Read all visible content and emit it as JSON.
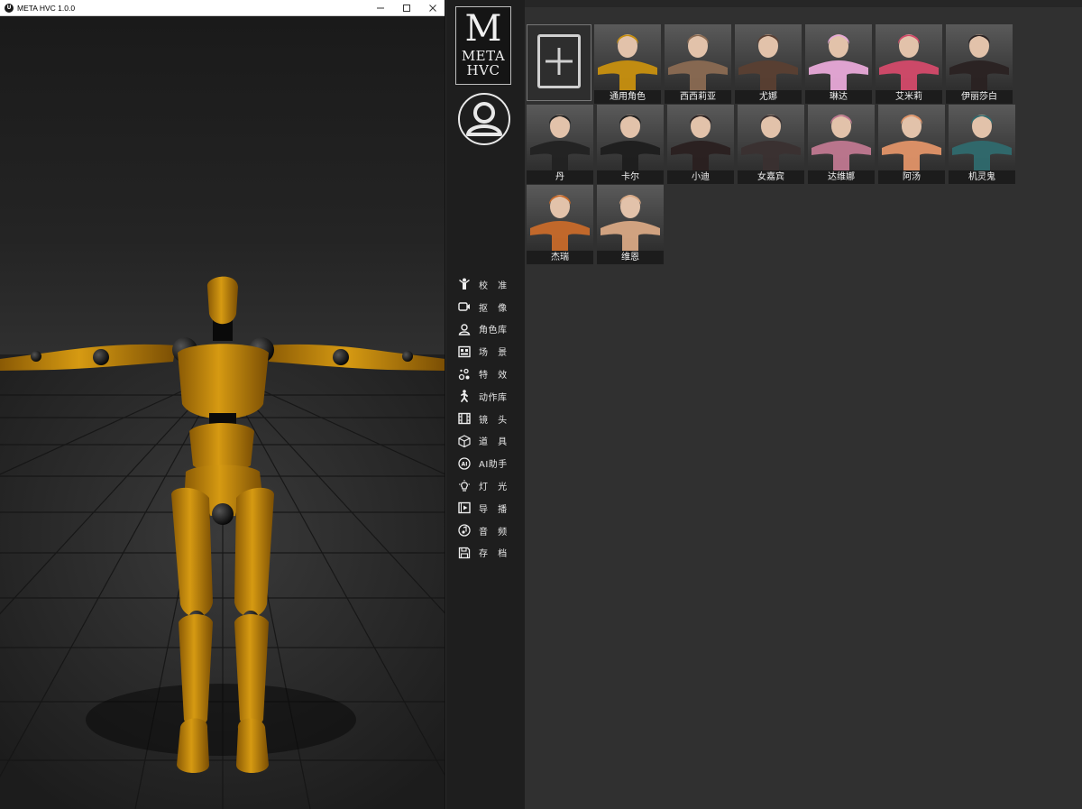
{
  "window": {
    "title": "META HVC 1.0.0",
    "minimize": "—",
    "maximize": "☐",
    "close": "✕"
  },
  "logo": {
    "letter": "M",
    "line1": "META",
    "line2": "HVC"
  },
  "menu": [
    {
      "label": "校 准",
      "icon": "calibrate-icon"
    },
    {
      "label": "抠 像",
      "icon": "camera-icon"
    },
    {
      "label": "角色库",
      "icon": "character-icon"
    },
    {
      "label": "场 景",
      "icon": "scene-icon"
    },
    {
      "label": "特 效",
      "icon": "effects-icon"
    },
    {
      "label": "动作库",
      "icon": "motion-icon"
    },
    {
      "label": "镜 头",
      "icon": "film-icon"
    },
    {
      "label": "道 具",
      "icon": "cube-icon"
    },
    {
      "label": "AI助手",
      "icon": "ai-icon"
    },
    {
      "label": "灯 光",
      "icon": "light-icon"
    },
    {
      "label": "导 播",
      "icon": "director-icon"
    },
    {
      "label": "音 频",
      "icon": "audio-icon"
    },
    {
      "label": "存 档",
      "icon": "save-icon"
    }
  ],
  "characters": [
    {
      "name": "通用角色",
      "color": "#c8900f"
    },
    {
      "name": "西西莉亚",
      "color": "#8a6a52"
    },
    {
      "name": "尤娜",
      "color": "#5a3f32"
    },
    {
      "name": "琳达",
      "color": "#e8a9d8"
    },
    {
      "name": "艾米莉",
      "color": "#d44a6a"
    },
    {
      "name": "伊丽莎白",
      "color": "#2a2222"
    },
    {
      "name": "丹",
      "color": "#222222"
    },
    {
      "name": "卡尔",
      "color": "#1e1e1e"
    },
    {
      "name": "小迪",
      "color": "#2a2020"
    },
    {
      "name": "女嘉宾",
      "color": "#3a3030"
    },
    {
      "name": "达维娜",
      "color": "#c07890"
    },
    {
      "name": "阿汤",
      "color": "#e29468"
    },
    {
      "name": "机灵鬼",
      "color": "#2f6a6e"
    },
    {
      "name": "杰瑞",
      "color": "#c86a2a"
    },
    {
      "name": "维恩",
      "color": "#d8a884"
    }
  ]
}
